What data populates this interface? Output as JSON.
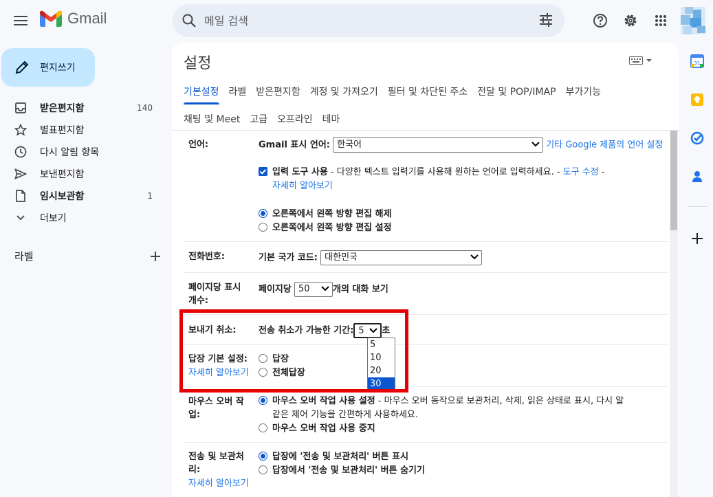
{
  "app": {
    "name": "Gmail"
  },
  "search": {
    "placeholder": "메일 검색"
  },
  "compose": {
    "label": "편지쓰기"
  },
  "nav": [
    {
      "label": "받은편지함",
      "count": "140",
      "icon": "inbox-icon",
      "bold": true
    },
    {
      "label": "별표편지함",
      "count": "",
      "icon": "star-icon",
      "bold": false
    },
    {
      "label": "다시 알림 항목",
      "count": "",
      "icon": "clock-icon",
      "bold": false
    },
    {
      "label": "보낸편지함",
      "count": "",
      "icon": "send-icon",
      "bold": false
    },
    {
      "label": "임시보관함",
      "count": "1",
      "icon": "draft-icon",
      "bold": true
    },
    {
      "label": "더보기",
      "count": "",
      "icon": "chevron-down-icon",
      "bold": false
    }
  ],
  "labels_header": "라벨",
  "settings": {
    "title": "설정",
    "tabs_row1": [
      "기본설정",
      "라벨",
      "받은편지함",
      "계정 및 가져오기",
      "필터 및 차단된 주소",
      "전달 및 POP/IMAP",
      "부가기능"
    ],
    "tabs_row2": [
      "채팅 및 Meet",
      "고급",
      "오프라인",
      "테마"
    ],
    "active_tab": "기본설정",
    "language": {
      "label": "언어:",
      "display_label": "Gmail 표시 언어:",
      "value": "한국어",
      "other_link": "기타 Google 제품의 언어 설정",
      "input_tools_label": "입력 도구 사용",
      "input_tools_desc": " - 다양한 텍스트 입력기를 사용해 원하는 언어로 입력하세요. - ",
      "edit_tools_link": "도구 수정",
      "dash": " -",
      "learn_more": "자세히 알아보기",
      "rtl_off": "오른쪽에서 왼쪽 방향 편집 해제",
      "rtl_on": "오른쪽에서 왼쪽 방향 편집 설정"
    },
    "phone": {
      "label": "전화번호:",
      "country_label": "기본 국가 코드:",
      "country_value": "대한민국"
    },
    "page_size": {
      "label_line1": "페이지당 표시",
      "label_line2": "개수:",
      "prefix": "페이지당",
      "value": "50",
      "suffix": "개의 대화 보기"
    },
    "undo_send": {
      "label": "보내기 취소:",
      "desc": "전송 취소가 가능한 기간:",
      "value": "5",
      "unit": "초",
      "options": [
        "5",
        "10",
        "20",
        "30"
      ],
      "highlighted_option": "30"
    },
    "reply": {
      "label": "답장 기본 설정:",
      "learn_more": "자세히 알아보기",
      "opt_reply": "답장",
      "opt_reply_all": "전체답장"
    },
    "hover": {
      "label_line1": "마우스 오버 작",
      "label_line2": "업:",
      "on_label": "마우스 오버 작업 사용 설정",
      "on_desc_1": " - 마우스 오버 동작으로 보관처리, 삭제, 읽은 상태로 표시, 다시 알",
      "on_desc_2": "같은 제어 기능을 간편하게 사용하세요.",
      "off_label": "마우스 오버 작업 사용 중지"
    },
    "send_archive": {
      "label_line1": "전송 및 보관처",
      "label_line2": "리:",
      "learn_more": "자세히 알아보기",
      "show": "답장에 '전송 및 보관처리' 버튼 표시",
      "hide": "답장에서 '전송 및 보관처리' 버튼 숨기기"
    }
  },
  "colors": {
    "accent": "#0b57d0",
    "compose_bg": "#c2e7ff",
    "highlight": "#e60000",
    "link": "#1a73e8"
  }
}
